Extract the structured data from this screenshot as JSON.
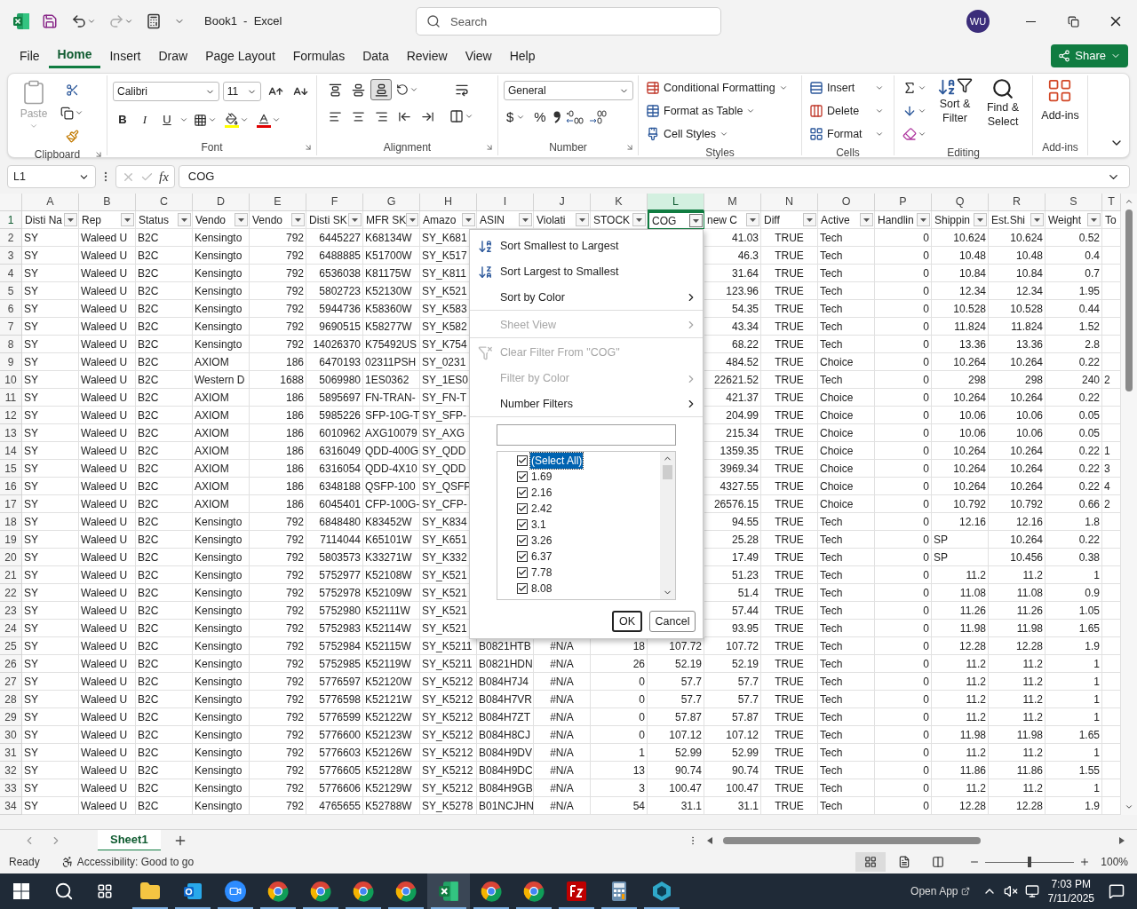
{
  "title_bar": {
    "title": "Book1  -  Excel",
    "avatar": "WU"
  },
  "search": {
    "placeholder": "Search"
  },
  "menu_tabs": [
    {
      "label": "File",
      "selected": false
    },
    {
      "label": "Home",
      "selected": true
    },
    {
      "label": "Insert",
      "selected": false
    },
    {
      "label": "Draw",
      "selected": false
    },
    {
      "label": "Page Layout",
      "selected": false
    },
    {
      "label": "Formulas",
      "selected": false
    },
    {
      "label": "Data",
      "selected": false
    },
    {
      "label": "Review",
      "selected": false
    },
    {
      "label": "View",
      "selected": false
    },
    {
      "label": "Help",
      "selected": false
    }
  ],
  "share": "Share",
  "ribbon": {
    "groups": [
      {
        "kind": "clipboard",
        "label": "Clipboard",
        "paste": {
          "label": "Paste",
          "disabled": true
        }
      },
      {
        "kind": "font",
        "label": "Font",
        "font": "Calibri",
        "size": "11",
        "bold": "B",
        "italic": "I",
        "underline": "U"
      },
      {
        "kind": "alignment",
        "label": "Alignment",
        "vertical_align": [
          {
            "kind": "top",
            "selected": false
          },
          {
            "kind": "middle",
            "selected": false
          },
          {
            "kind": "bottom",
            "selected": true
          }
        ]
      },
      {
        "kind": "number",
        "label": "Number",
        "format": "General",
        "currency": "$",
        "percent": "%"
      },
      {
        "kind": "styles",
        "label": "Styles",
        "buttons": [
          "Conditional Formatting",
          "Format as Table",
          "Cell Styles"
        ]
      },
      {
        "kind": "cells",
        "label": "Cells",
        "buttons": [
          "Insert",
          "Delete",
          "Format"
        ]
      },
      {
        "kind": "editing",
        "label": "Editing",
        "buttons": [
          "Sort & Filter",
          "Find & Select"
        ]
      },
      {
        "kind": "addins",
        "label": "Add-ins",
        "buttons": [
          "Add-ins"
        ]
      }
    ]
  },
  "formula_bar": {
    "name_box": "L1",
    "fx": "fx",
    "value": "COG"
  },
  "columns": [
    {
      "letter": "A",
      "label": "Disti Na",
      "kind": "text",
      "filter": true,
      "selected": false
    },
    {
      "letter": "B",
      "label": "Rep",
      "kind": "text",
      "filter": true,
      "selected": false
    },
    {
      "letter": "C",
      "label": "Status",
      "kind": "text",
      "filter": true,
      "selected": false
    },
    {
      "letter": "D",
      "label": "Vendo",
      "kind": "text",
      "filter": true,
      "selected": false
    },
    {
      "letter": "E",
      "label": "Vendo",
      "kind": "number",
      "filter": true,
      "selected": false
    },
    {
      "letter": "F",
      "label": "Disti SK",
      "kind": "number",
      "filter": true,
      "selected": false
    },
    {
      "letter": "G",
      "label": "MFR SK",
      "kind": "text",
      "filter": true,
      "selected": false
    },
    {
      "letter": "H",
      "label": "Amazo",
      "kind": "text",
      "filter": true,
      "selected": false
    },
    {
      "letter": "I",
      "label": "ASIN",
      "kind": "text",
      "filter": true,
      "selected": false
    },
    {
      "letter": "J",
      "label": "Violati",
      "kind": "flag",
      "filter": true,
      "selected": false
    },
    {
      "letter": "K",
      "label": "STOCK",
      "kind": "number",
      "filter": true,
      "selected": false
    },
    {
      "letter": "L",
      "label": "COG",
      "kind": "number",
      "filter": true,
      "selected": true
    },
    {
      "letter": "M",
      "label": "new C",
      "kind": "number",
      "filter": true,
      "selected": false
    },
    {
      "letter": "N",
      "label": "Diff",
      "kind": "flag",
      "filter": true,
      "selected": false
    },
    {
      "letter": "O",
      "label": "Active",
      "kind": "text",
      "filter": true,
      "selected": false
    },
    {
      "letter": "P",
      "label": "Handlin",
      "kind": "number",
      "filter": true,
      "selected": false
    },
    {
      "letter": "Q",
      "label": "Shippin",
      "kind": "number",
      "filter": true,
      "selected": false
    },
    {
      "letter": "R",
      "label": "Est.Shi",
      "kind": "number",
      "filter": true,
      "selected": false
    },
    {
      "letter": "S",
      "label": "Weight",
      "kind": "number",
      "filter": true,
      "selected": false
    },
    {
      "letter": "T",
      "label": "To",
      "kind": "text",
      "filter": false,
      "selected": false
    }
  ],
  "header_row": "1",
  "rows": [
    {
      "n": "2",
      "cells": [
        "SY",
        "Waleed U",
        "B2C",
        "Kensingto",
        "792",
        "6445227",
        "K68134W",
        "SY_K681",
        null,
        null,
        null,
        null,
        "41.03",
        "TRUE",
        "Tech",
        "0",
        "10.624",
        "10.624",
        "0.52",
        null
      ]
    },
    {
      "n": "3",
      "cells": [
        "SY",
        "Waleed U",
        "B2C",
        "Kensingto",
        "792",
        "6488885",
        "K51700W",
        "SY_K517",
        null,
        null,
        null,
        null,
        "46.3",
        "TRUE",
        "Tech",
        "0",
        "10.48",
        "10.48",
        "0.4",
        null
      ]
    },
    {
      "n": "4",
      "cells": [
        "SY",
        "Waleed U",
        "B2C",
        "Kensingto",
        "792",
        "6536038",
        "K81175W",
        "SY_K811",
        null,
        null,
        null,
        null,
        "31.64",
        "TRUE",
        "Tech",
        "0",
        "10.84",
        "10.84",
        "0.7",
        null
      ]
    },
    {
      "n": "5",
      "cells": [
        "SY",
        "Waleed U",
        "B2C",
        "Kensingto",
        "792",
        "5802723",
        "K52130W",
        "SY_K521",
        null,
        null,
        null,
        null,
        "123.96",
        "TRUE",
        "Tech",
        "0",
        "12.34",
        "12.34",
        "1.95",
        null
      ]
    },
    {
      "n": "6",
      "cells": [
        "SY",
        "Waleed U",
        "B2C",
        "Kensingto",
        "792",
        "5944736",
        "K58360W",
        "SY_K583",
        null,
        null,
        null,
        null,
        "54.35",
        "TRUE",
        "Tech",
        "0",
        "10.528",
        "10.528",
        "0.44",
        null
      ]
    },
    {
      "n": "7",
      "cells": [
        "SY",
        "Waleed U",
        "B2C",
        "Kensingto",
        "792",
        "9690515",
        "K58277W",
        "SY_K582",
        null,
        null,
        null,
        null,
        "43.34",
        "TRUE",
        "Tech",
        "0",
        "11.824",
        "11.824",
        "1.52",
        null
      ]
    },
    {
      "n": "8",
      "cells": [
        "SY",
        "Waleed U",
        "B2C",
        "Kensingto",
        "792",
        "14026370",
        "K75492US",
        "SY_K754",
        null,
        null,
        null,
        null,
        "68.22",
        "TRUE",
        "Tech",
        "0",
        "13.36",
        "13.36",
        "2.8",
        null
      ]
    },
    {
      "n": "9",
      "cells": [
        "SY",
        "Waleed U",
        "B2C",
        "AXIOM",
        "186",
        "6470193",
        "02311PSH",
        "SY_0231",
        null,
        null,
        null,
        null,
        "484.52",
        "TRUE",
        "Choice",
        "0",
        "10.264",
        "10.264",
        "0.22",
        null
      ]
    },
    {
      "n": "10",
      "cells": [
        "SY",
        "Waleed U",
        "B2C",
        "Western D",
        "1688",
        "5069980",
        "1ES0362",
        "SY_1ES0",
        null,
        null,
        null,
        null,
        "22621.52",
        "TRUE",
        "Tech",
        "0",
        "298",
        "298",
        "240",
        "2"
      ]
    },
    {
      "n": "11",
      "cells": [
        "SY",
        "Waleed U",
        "B2C",
        "AXIOM",
        "186",
        "5895697",
        "FN-TRAN-",
        "SY_FN-T",
        null,
        null,
        null,
        null,
        "421.37",
        "TRUE",
        "Choice",
        "0",
        "10.264",
        "10.264",
        "0.22",
        null
      ]
    },
    {
      "n": "12",
      "cells": [
        "SY",
        "Waleed U",
        "B2C",
        "AXIOM",
        "186",
        "5985226",
        "SFP-10G-T",
        "SY_SFP-",
        null,
        null,
        null,
        null,
        "204.99",
        "TRUE",
        "Choice",
        "0",
        "10.06",
        "10.06",
        "0.05",
        null
      ]
    },
    {
      "n": "13",
      "cells": [
        "SY",
        "Waleed U",
        "B2C",
        "AXIOM",
        "186",
        "6010962",
        "AXG10079",
        "SY_AXG",
        null,
        null,
        null,
        null,
        "215.34",
        "TRUE",
        "Choice",
        "0",
        "10.06",
        "10.06",
        "0.05",
        null
      ]
    },
    {
      "n": "14",
      "cells": [
        "SY",
        "Waleed U",
        "B2C",
        "AXIOM",
        "186",
        "6316049",
        "QDD-400G",
        "SY_QDD",
        null,
        null,
        null,
        null,
        "1359.35",
        "TRUE",
        "Choice",
        "0",
        "10.264",
        "10.264",
        "0.22",
        "1"
      ]
    },
    {
      "n": "15",
      "cells": [
        "SY",
        "Waleed U",
        "B2C",
        "AXIOM",
        "186",
        "6316054",
        "QDD-4X10",
        "SY_QDD",
        null,
        null,
        null,
        null,
        "3969.34",
        "TRUE",
        "Choice",
        "0",
        "10.264",
        "10.264",
        "0.22",
        "3"
      ]
    },
    {
      "n": "16",
      "cells": [
        "SY",
        "Waleed U",
        "B2C",
        "AXIOM",
        "186",
        "6348188",
        "QSFP-100",
        "SY_QSFP",
        null,
        null,
        null,
        null,
        "4327.55",
        "TRUE",
        "Choice",
        "0",
        "10.264",
        "10.264",
        "0.22",
        "4"
      ]
    },
    {
      "n": "17",
      "cells": [
        "SY",
        "Waleed U",
        "B2C",
        "AXIOM",
        "186",
        "6045401",
        "CFP-100G-",
        "SY_CFP-",
        null,
        null,
        null,
        null,
        "26576.15",
        "TRUE",
        "Choice",
        "0",
        "10.792",
        "10.792",
        "0.66",
        "2"
      ]
    },
    {
      "n": "18",
      "cells": [
        "SY",
        "Waleed U",
        "B2C",
        "Kensingto",
        "792",
        "6848480",
        "K83452W",
        "SY_K834",
        null,
        null,
        null,
        null,
        "94.55",
        "TRUE",
        "Tech",
        "0",
        "12.16",
        "12.16",
        "1.8",
        null
      ]
    },
    {
      "n": "19",
      "cells": [
        "SY",
        "Waleed U",
        "B2C",
        "Kensingto",
        "792",
        "7114044",
        "K65101W",
        "SY_K651",
        null,
        null,
        null,
        null,
        "25.28",
        "TRUE",
        "Tech",
        "0",
        {
          "text": "SP",
          "kind": "text"
        },
        "10.264",
        "0.22",
        null
      ]
    },
    {
      "n": "20",
      "cells": [
        "SY",
        "Waleed U",
        "B2C",
        "Kensingto",
        "792",
        "5803573",
        "K33271W",
        "SY_K332",
        null,
        null,
        null,
        null,
        "17.49",
        "TRUE",
        "Tech",
        "0",
        {
          "text": "SP",
          "kind": "text"
        },
        "10.456",
        "0.38",
        null
      ]
    },
    {
      "n": "21",
      "cells": [
        "SY",
        "Waleed U",
        "B2C",
        "Kensingto",
        "792",
        "5752977",
        "K52108W",
        "SY_K521",
        null,
        null,
        null,
        null,
        "51.23",
        "TRUE",
        "Tech",
        "0",
        "11.2",
        "11.2",
        "1",
        null
      ]
    },
    {
      "n": "22",
      "cells": [
        "SY",
        "Waleed U",
        "B2C",
        "Kensingto",
        "792",
        "5752978",
        "K52109W",
        "SY_K521",
        null,
        null,
        null,
        null,
        "51.4",
        "TRUE",
        "Tech",
        "0",
        "11.08",
        "11.08",
        "0.9",
        null
      ]
    },
    {
      "n": "23",
      "cells": [
        "SY",
        "Waleed U",
        "B2C",
        "Kensingto",
        "792",
        "5752980",
        "K52111W",
        "SY_K521",
        null,
        null,
        null,
        null,
        "57.44",
        "TRUE",
        "Tech",
        "0",
        "11.26",
        "11.26",
        "1.05",
        null
      ]
    },
    {
      "n": "24",
      "cells": [
        "SY",
        "Waleed U",
        "B2C",
        "Kensingto",
        "792",
        "5752983",
        "K52114W",
        "SY_K521",
        null,
        null,
        null,
        null,
        "93.95",
        "TRUE",
        "Tech",
        "0",
        "11.98",
        "11.98",
        "1.65",
        null
      ]
    },
    {
      "n": "25",
      "cells": [
        "SY",
        "Waleed U",
        "B2C",
        "Kensingto",
        "792",
        "5752984",
        "K52115W",
        "SY_K5211",
        "B0821HTB",
        "#N/A",
        "18",
        "107.72",
        "107.72",
        "TRUE",
        "Tech",
        "0",
        "12.28",
        "12.28",
        "1.9",
        null
      ]
    },
    {
      "n": "26",
      "cells": [
        "SY",
        "Waleed U",
        "B2C",
        "Kensingto",
        "792",
        "5752985",
        "K52119W",
        "SY_K5211",
        "B0821HDN",
        "#N/A",
        "26",
        "52.19",
        "52.19",
        "TRUE",
        "Tech",
        "0",
        "11.2",
        "11.2",
        "1",
        null
      ]
    },
    {
      "n": "27",
      "cells": [
        "SY",
        "Waleed U",
        "B2C",
        "Kensingto",
        "792",
        "5776597",
        "K52120W",
        "SY_K5212",
        "B084H7J4",
        "#N/A",
        "0",
        "57.7",
        "57.7",
        "TRUE",
        "Tech",
        "0",
        "11.2",
        "11.2",
        "1",
        null
      ]
    },
    {
      "n": "28",
      "cells": [
        "SY",
        "Waleed U",
        "B2C",
        "Kensingto",
        "792",
        "5776598",
        "K52121W",
        "SY_K5212",
        "B084H7VR",
        "#N/A",
        "0",
        "57.7",
        "57.7",
        "TRUE",
        "Tech",
        "0",
        "11.2",
        "11.2",
        "1",
        null
      ]
    },
    {
      "n": "29",
      "cells": [
        "SY",
        "Waleed U",
        "B2C",
        "Kensingto",
        "792",
        "5776599",
        "K52122W",
        "SY_K5212",
        "B084H7ZT",
        "#N/A",
        "0",
        "57.87",
        "57.87",
        "TRUE",
        "Tech",
        "0",
        "11.2",
        "11.2",
        "1",
        null
      ]
    },
    {
      "n": "30",
      "cells": [
        "SY",
        "Waleed U",
        "B2C",
        "Kensingto",
        "792",
        "5776600",
        "K52123W",
        "SY_K5212",
        "B084H8CJ",
        "#N/A",
        "0",
        "107.12",
        "107.12",
        "TRUE",
        "Tech",
        "0",
        "11.98",
        "11.98",
        "1.65",
        null
      ]
    },
    {
      "n": "31",
      "cells": [
        "SY",
        "Waleed U",
        "B2C",
        "Kensingto",
        "792",
        "5776603",
        "K52126W",
        "SY_K5212",
        "B084H9DV",
        "#N/A",
        "1",
        "52.99",
        "52.99",
        "TRUE",
        "Tech",
        "0",
        "11.2",
        "11.2",
        "1",
        null
      ]
    },
    {
      "n": "32",
      "cells": [
        "SY",
        "Waleed U",
        "B2C",
        "Kensingto",
        "792",
        "5776605",
        "K52128W",
        "SY_K5212",
        "B084H9DC",
        "#N/A",
        "13",
        "90.74",
        "90.74",
        "TRUE",
        "Tech",
        "0",
        "11.86",
        "11.86",
        "1.55",
        null
      ]
    },
    {
      "n": "33",
      "cells": [
        "SY",
        "Waleed U",
        "B2C",
        "Kensingto",
        "792",
        "5776606",
        "K52129W",
        "SY_K5212",
        "B084H9GB",
        "#N/A",
        "3",
        "100.47",
        "100.47",
        "TRUE",
        "Tech",
        "0",
        "11.2",
        "11.2",
        "1",
        null
      ]
    },
    {
      "n": "34",
      "cells": [
        "SY",
        "Waleed U",
        "B2C",
        "Kensingto",
        "792",
        "4765655",
        "K52788W",
        "SY_K5278",
        "B01NCJHN",
        "#N/A",
        "54",
        "31.1",
        "31.1",
        "TRUE",
        "Tech",
        "0",
        "12.28",
        "12.28",
        "1.9",
        null
      ]
    }
  ],
  "filter_menu": {
    "items": [
      {
        "kind": "sort_asc",
        "label": "Sort Smallest to Largest",
        "disabled": false,
        "submenu": false,
        "separator_after": false
      },
      {
        "kind": "sort_desc",
        "label": "Sort Largest to Smallest",
        "disabled": false,
        "submenu": false,
        "separator_after": false
      },
      {
        "kind": "plain",
        "label": "Sort by Color",
        "disabled": false,
        "submenu": true,
        "separator_after": true
      },
      {
        "kind": "plain",
        "label": "Sheet View",
        "disabled": true,
        "submenu": true,
        "separator_after": true
      },
      {
        "kind": "clear_filter",
        "label": "Clear Filter From \"COG\"",
        "disabled": true,
        "submenu": false,
        "separator_after": false
      },
      {
        "kind": "plain",
        "label": "Filter by Color",
        "disabled": true,
        "submenu": true,
        "separator_after": false
      },
      {
        "kind": "plain",
        "label": "Number Filters",
        "disabled": false,
        "submenu": true,
        "separator_after": true
      }
    ],
    "values": [
      {
        "label": "(Select All)",
        "checked": true,
        "selected": true
      },
      {
        "label": "1.69",
        "checked": true,
        "selected": false
      },
      {
        "label": "2.16",
        "checked": true,
        "selected": false
      },
      {
        "label": "2.42",
        "checked": true,
        "selected": false
      },
      {
        "label": "3.1",
        "checked": true,
        "selected": false
      },
      {
        "label": "3.26",
        "checked": true,
        "selected": false
      },
      {
        "label": "6.37",
        "checked": true,
        "selected": false
      },
      {
        "label": "7.78",
        "checked": true,
        "selected": false
      },
      {
        "label": "8.08",
        "checked": true,
        "selected": false
      }
    ],
    "ok": "OK",
    "cancel": "Cancel"
  },
  "sheets": [
    {
      "label": "Sheet1",
      "selected": true
    }
  ],
  "status_bar": {
    "status": "Ready",
    "accessibility": "Accessibility: Good to go",
    "views": [
      {
        "kind": "normal",
        "selected": true
      },
      {
        "kind": "page_layout",
        "selected": false
      },
      {
        "kind": "page_break",
        "selected": false
      }
    ],
    "zoom": {
      "level": 0.5,
      "reading": "100%"
    }
  },
  "taskbar": {
    "apps": [
      {
        "kind": "explorer",
        "active": false
      },
      {
        "kind": "outlook",
        "active": false
      },
      {
        "kind": "zoom",
        "active": false
      },
      {
        "kind": "chrome",
        "active": false
      },
      {
        "kind": "chrome",
        "active": false
      },
      {
        "kind": "chrome",
        "active": false
      },
      {
        "kind": "chrome",
        "active": false
      },
      {
        "kind": "excel",
        "active": true
      },
      {
        "kind": "chrome",
        "active": false
      },
      {
        "kind": "chrome",
        "active": false
      },
      {
        "kind": "filezilla",
        "active": false
      },
      {
        "kind": "calculator",
        "active": false
      },
      {
        "kind": "gem",
        "active": false
      }
    ],
    "open_app": "Open App",
    "time": "7:03 PM",
    "date": "7/11/2025"
  }
}
